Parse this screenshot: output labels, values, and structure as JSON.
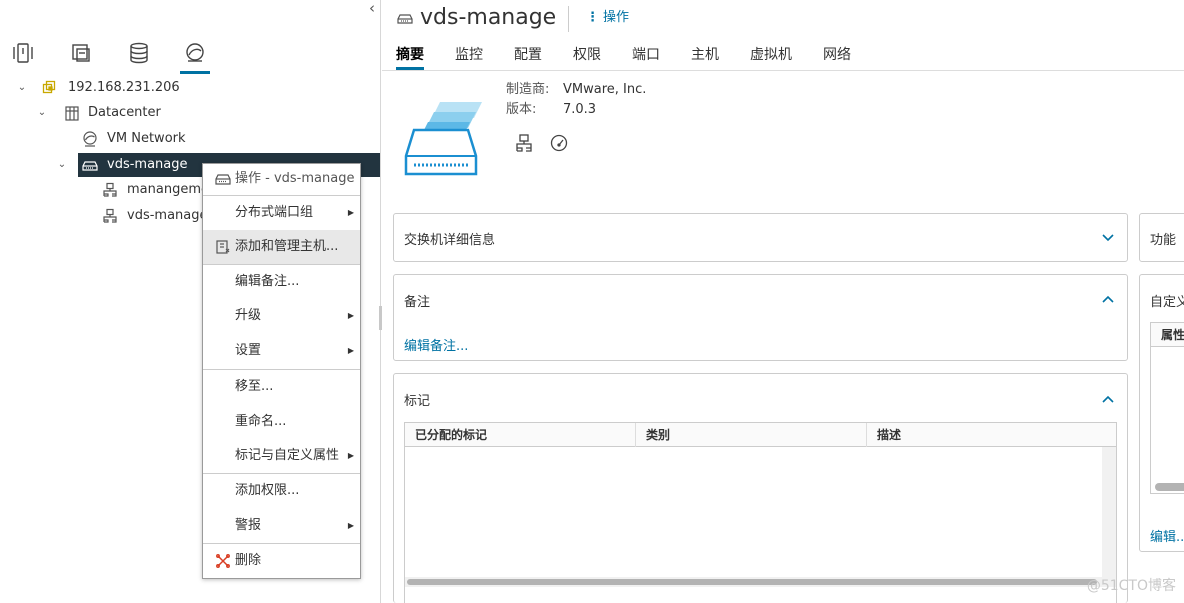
{
  "nav": {
    "collapse_glyph": "‹",
    "tabs": [
      {
        "name": "hosts-clusters-tab",
        "icon": "hosts-clusters-icon"
      },
      {
        "name": "vms-templates-tab",
        "icon": "vms-templates-icon"
      },
      {
        "name": "storage-tab",
        "icon": "storage-icon"
      },
      {
        "name": "networking-tab",
        "icon": "networking-icon",
        "active": true
      }
    ],
    "tree": [
      {
        "label": "192.168.231.206",
        "icon": "vcenter-icon",
        "caret": "⌄"
      },
      {
        "label": "Datacenter",
        "icon": "datacenter-icon",
        "caret": "⌄"
      },
      {
        "label": "VM Network",
        "icon": "network-icon",
        "caret": ""
      },
      {
        "label": "vds-manage",
        "icon": "vds-icon",
        "caret": "⌄",
        "selected": true
      },
      {
        "label": "manangeme",
        "icon": "portgroup-icon",
        "caret": ""
      },
      {
        "label": "vds-manage",
        "icon": "portgroup-icon",
        "caret": ""
      }
    ]
  },
  "context_menu": {
    "header": "操作 - vds-manage",
    "items": [
      {
        "label": "分布式端口组",
        "submenu": true
      },
      {
        "label": "添加和管理主机...",
        "submenu": false,
        "hover": true
      },
      {
        "label": "编辑备注...",
        "submenu": false
      },
      {
        "label": "升级",
        "submenu": true
      },
      {
        "label": "设置",
        "submenu": true
      },
      {
        "label": "移至...",
        "submenu": false
      },
      {
        "label": "重命名...",
        "submenu": false
      },
      {
        "label": "标记与自定义属性",
        "submenu": true
      },
      {
        "label": "添加权限...",
        "submenu": false
      },
      {
        "label": "警报",
        "submenu": true
      },
      {
        "label": "删除",
        "submenu": false
      }
    ],
    "arrow_glyph": "▶"
  },
  "main": {
    "title": "vds-manage",
    "actions_dots": "⋮",
    "actions_label": "操作",
    "tabs": [
      "摘要",
      "监控",
      "配置",
      "权限",
      "端口",
      "主机",
      "虚拟机",
      "网络"
    ],
    "active_tab": "摘要",
    "summary": {
      "vendor_label": "制造商:",
      "vendor_value": "VMware, Inc.",
      "version_label": "版本:",
      "version_value": "7.0.3"
    },
    "cards": {
      "switch_details": "交换机详细信息",
      "notes_title": "备注",
      "notes_link": "编辑备注...",
      "tags_title": "标记",
      "tags_columns": [
        "已分配的标记",
        "类别",
        "描述"
      ],
      "features_title": "功能",
      "custom_title": "自定义",
      "custom_column": "属性",
      "custom_link": "编辑..."
    },
    "watermark": "@51CTO博客"
  },
  "colors": {
    "accent": "#0072a3",
    "selected_row": "#22343f",
    "delete_icon": "#d93f25"
  }
}
